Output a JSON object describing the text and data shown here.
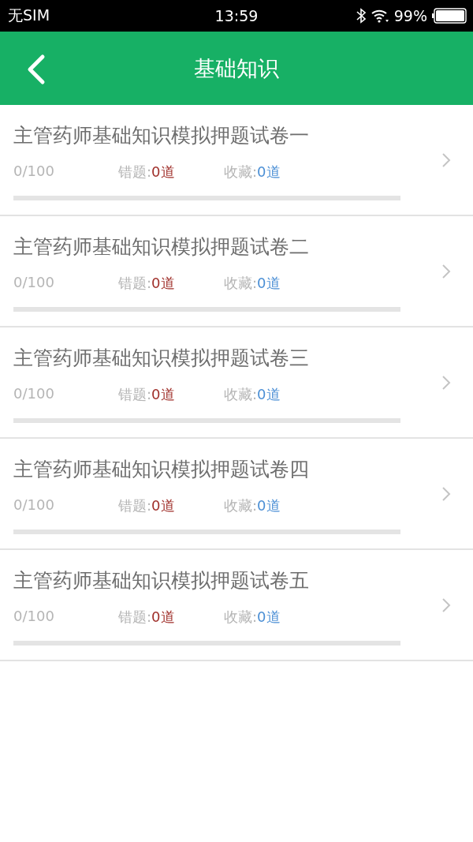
{
  "status_bar": {
    "carrier": "无SIM",
    "time": "13:59",
    "battery": "99%"
  },
  "nav_bar": {
    "title": "基础知识"
  },
  "papers": [
    {
      "title": "主管药师基础知识模拟押题试卷一",
      "progress": "0/100",
      "wrong_label": "错题:",
      "wrong_count": "0道",
      "fav_label": "收藏:",
      "fav_count": "0道",
      "level": 0
    },
    {
      "title": "主管药师基础知识模拟押题试卷二",
      "progress": "0/100",
      "wrong_label": "错题:",
      "wrong_count": "0道",
      "fav_label": "收藏:",
      "fav_count": "0道",
      "level": 0
    },
    {
      "title": "主管药师基础知识模拟押题试卷三",
      "progress": "0/100",
      "wrong_label": "错题:",
      "wrong_count": "0道",
      "fav_label": "收藏:",
      "fav_count": "0道",
      "level": 0
    },
    {
      "title": "主管药师基础知识模拟押题试卷四",
      "progress": "0/100",
      "wrong_label": "错题:",
      "wrong_count": "0道",
      "fav_label": "收藏:",
      "fav_count": "0道",
      "level": 0
    },
    {
      "title": "主管药师基础知识模拟押题试卷五",
      "progress": "0/100",
      "wrong_label": "错题:",
      "wrong_count": "0道",
      "fav_label": "收藏:",
      "fav_count": "0道",
      "level": 0
    }
  ]
}
